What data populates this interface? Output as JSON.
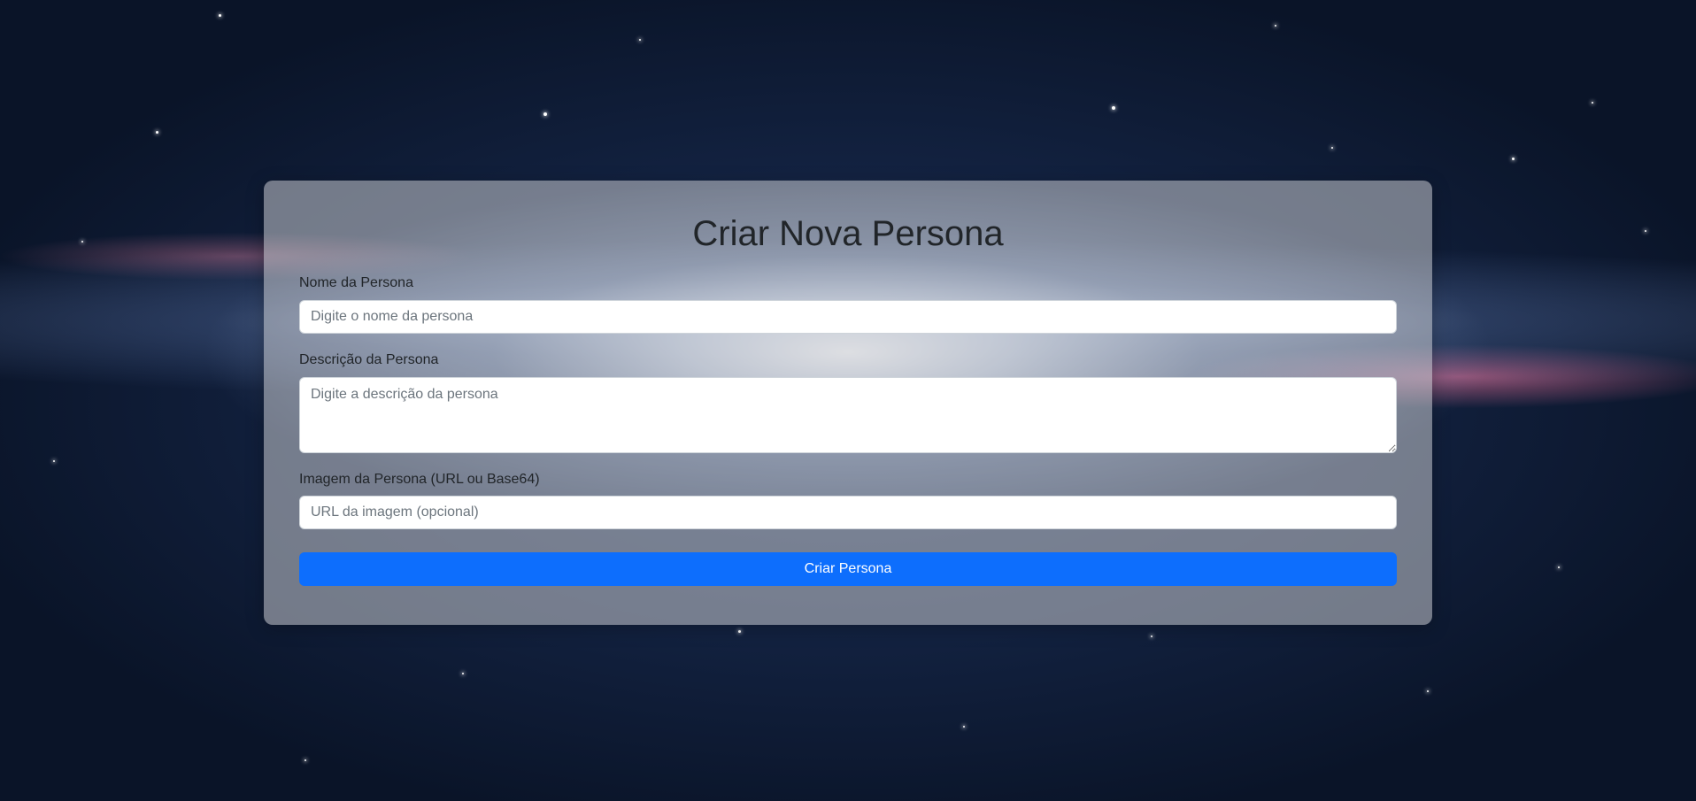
{
  "form": {
    "title": "Criar Nova Persona",
    "name_label": "Nome da Persona",
    "name_placeholder": "Digite o nome da persona",
    "description_label": "Descrição da Persona",
    "description_placeholder": "Digite a descrição da persona",
    "image_label": "Imagem da Persona (URL ou Base64)",
    "image_placeholder": "URL da imagem (opcional)",
    "submit_label": "Criar Persona"
  },
  "colors": {
    "accent": "#0d6efd",
    "text": "#212529",
    "placeholder": "#6c757d"
  }
}
